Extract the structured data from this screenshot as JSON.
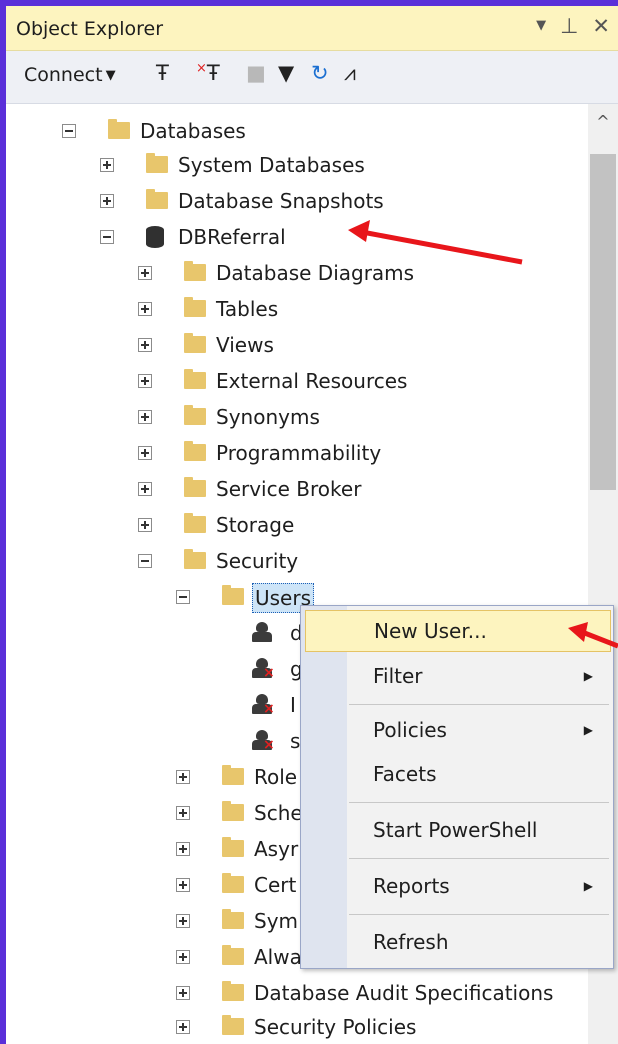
{
  "window": {
    "title": "Object Explorer",
    "icons": [
      "dropdown-icon",
      "pin-icon",
      "close-icon"
    ]
  },
  "toolbar": {
    "connect_label": "Connect",
    "tools": [
      "connect-plug-icon",
      "disconnect-plug-icon",
      "stop-icon",
      "filter-icon",
      "refresh-icon",
      "activity-monitor-icon"
    ]
  },
  "tree": {
    "databases": "Databases",
    "system_databases": "System Databases",
    "database_snapshots": "Database Snapshots",
    "dbreferral": "DBReferral",
    "database_diagrams": "Database Diagrams",
    "tables": "Tables",
    "views": "Views",
    "external_resources": "External Resources",
    "synonyms": "Synonyms",
    "programmability": "Programmability",
    "service_broker": "Service Broker",
    "storage": "Storage",
    "security": "Security",
    "users": "Users",
    "user1": "d",
    "user2": "g",
    "user3": "I",
    "user4": "s",
    "roles": "Role",
    "schemas": "Sche",
    "asymmetric": "Asyr",
    "certificates": "Cert",
    "symmetric": "Sym",
    "always": "Alwa",
    "db_audit_specs": "Database Audit Specifications",
    "security_policies": "Security Policies"
  },
  "context_menu": {
    "new_user": "New User...",
    "filter": "Filter",
    "policies": "Policies",
    "facets": "Facets",
    "start_powershell": "Start PowerShell",
    "reports": "Reports",
    "refresh": "Refresh"
  },
  "colors": {
    "frame": "#5a2fd9",
    "title_bg": "#fdf4bf",
    "annotation_arrow": "#e8161b",
    "selection": "#cde4f7"
  }
}
